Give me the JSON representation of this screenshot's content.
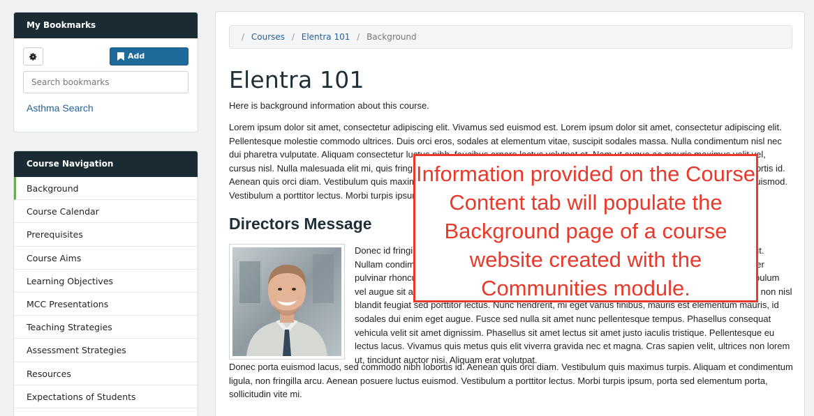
{
  "bookmarks": {
    "title": "My Bookmarks",
    "add_label": "Add Bookmark",
    "search_placeholder": "Search bookmarks",
    "items": [
      {
        "label": "Asthma Search"
      }
    ]
  },
  "course_nav": {
    "title": "Course Navigation",
    "items": [
      {
        "label": "Background"
      },
      {
        "label": "Course Calendar"
      },
      {
        "label": "Prerequisites"
      },
      {
        "label": "Course Aims"
      },
      {
        "label": "Learning Objectives"
      },
      {
        "label": "MCC Presentations"
      },
      {
        "label": "Teaching Strategies"
      },
      {
        "label": "Assessment Strategies"
      },
      {
        "label": "Resources"
      },
      {
        "label": "Expectations of Students"
      }
    ]
  },
  "breadcrumb": {
    "items": [
      {
        "label": "Courses"
      },
      {
        "label": "Elentra 101"
      }
    ],
    "current": "Background"
  },
  "main": {
    "title": "Elentra 101",
    "intro": "Here is background information about this course.",
    "paragraph1": "Lorem ipsum dolor sit amet, consectetur adipiscing elit. Vivamus sed euismod est. Lorem ipsum dolor sit amet, consectetur adipiscing elit. Pellentesque molestie commodo ultrices. Duis orci eros, sodales at elementum vitae, suscipit sodales massa. Nulla condimentum nisl nec dui pharetra vulputate. Aliquam consectetur luctus nibh, faucibus ornare lectus volutpat et. Nam ut augue ac mauris maximus velit vel, cursus nisl. Nulla malesuada elit mi, quis fringilla lorem tempus et. Pellentesque id mollis est, efficitur porttitor tellus. Donec eget lobortis id. Aenean quis orci diam. Vestibulum quis maximus turpis. Aliquam et condimentum ligula, non fringilla arcu. Aenean posuere luctus euismod. Vestibulum a porttitor lectus. Morbi turpis ipsum, porta sed elementum porta, sollicitudin vite mi.",
    "directors_title": "Directors Message",
    "director_paragraph": "Donec id fringilla tortor, et finibus nisi. Vivamus dapibus turpis magna, vehicula pharetra felis mattis ut. Nullam condimentum eros eget sodales aliquet. Curabitur eget tincidunt nisl, vel tincidunt odio. Integer pulvinar rhoncus massa sit amet elementum. Nec ultricies magna porta. Aliquam erat volutpat. Vestibulum vel augue sit amet mauris semper porta. Aliquam tempus nibh nec maximus enim. Maecenas ut sem non nisl blandit feugiat sed porttitor lectus. Nunc hendrerit, mi eget varius finibus, mauris est elementum mauris, id sodales dui enim eget augue. Fusce sed nulla sit amet nunc pellentesque tempus. Phasellus consequat vehicula velit sit amet dignissim. Phasellus sit amet lectus sit amet justo iaculis tristique. Pellentesque eu lectus lacus. Vivamus quis metus quis elit viverra gravida nec et magna. Cras sapien velit, ultrices non lorem ut, tincidunt auctor nisi. Aliquam erat volutpat.",
    "closing_paragraph": "Donec porta euismod lacus, sed commodo nibh lobortis id. Aenean quis orci diam. Vestibulum quis maximus turpis. Aliquam et condimentum ligula, non fringilla arcu. Aenean posuere luctus euismod. Vestibulum a porttitor lectus. Morbi turpis ipsum, porta sed elementum porta, sollicitudin vite mi."
  },
  "callout": {
    "text": "Information provided on the Course Content tab will populate the Background page of a course website created with the Communities module."
  },
  "colors": {
    "panel_header": "#1b2b33",
    "primary_button": "#1d6a9b",
    "link": "#23609a",
    "active_marker": "#6ea84f",
    "callout": "#e8392b"
  }
}
